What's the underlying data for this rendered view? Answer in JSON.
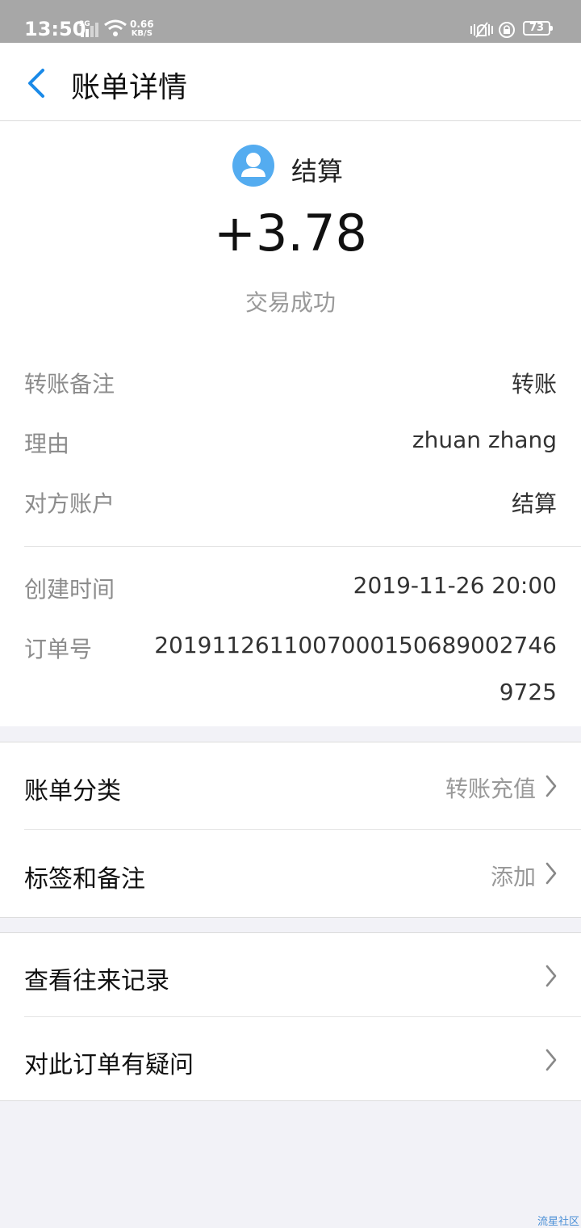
{
  "status_bar": {
    "time": "13:50",
    "network": "3G",
    "speed_value": "0.66",
    "speed_unit": "KB/S",
    "battery": "73"
  },
  "header": {
    "title": "账单详情"
  },
  "summary": {
    "payee": "结算",
    "amount": "+3.78",
    "status": "交易成功"
  },
  "details": [
    {
      "label": "转账备注",
      "value": "转账"
    },
    {
      "label": "理由",
      "value": "zhuan zhang"
    },
    {
      "label": "对方账户",
      "value": "结算"
    },
    {
      "label": "创建时间",
      "value": "2019-11-26 20:00"
    },
    {
      "label": "订单号",
      "value": "2019112611007000150689002746972​5"
    }
  ],
  "menu_group_1": [
    {
      "label": "账单分类",
      "value": "转账充值"
    },
    {
      "label": "标签和备注",
      "value": "添加"
    }
  ],
  "menu_group_2": [
    {
      "label": "查看往来记录"
    },
    {
      "label": "对此订单有疑问"
    }
  ],
  "watermark": "流星社区",
  "colors": {
    "accent": "#1a8ae8",
    "avatar": "#54acf0",
    "status_bar": "#a7a7a7",
    "background": "#f2f2f7"
  }
}
